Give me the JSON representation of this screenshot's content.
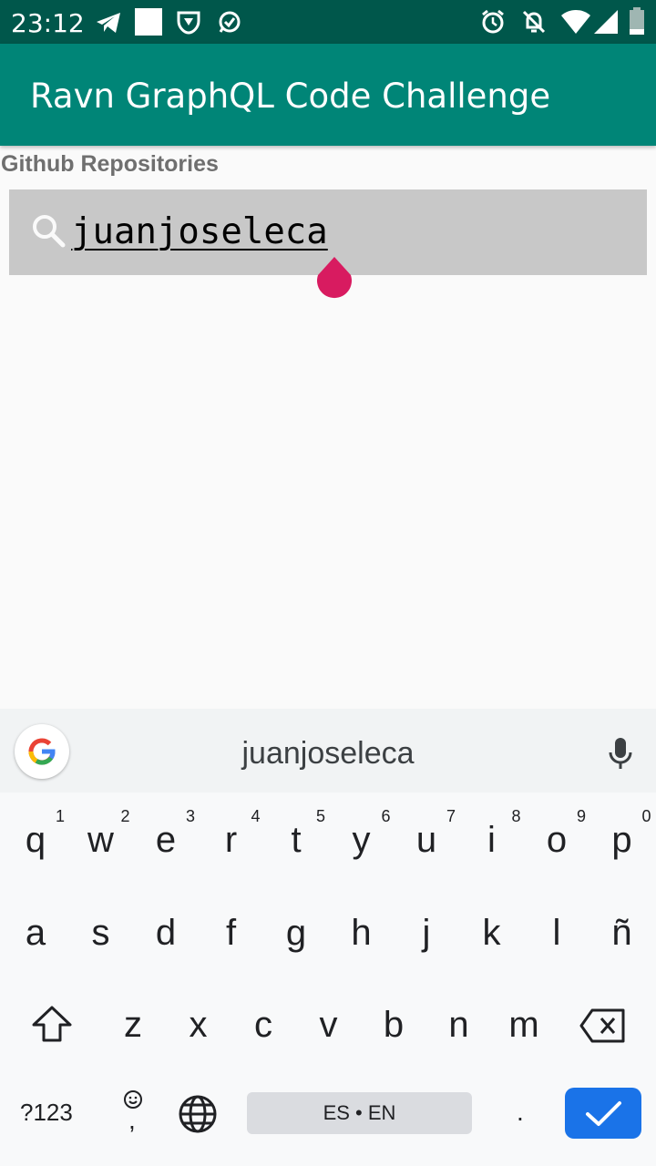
{
  "status_bar": {
    "time": "23:12",
    "left_icons": [
      "telegram-icon",
      "square-icon",
      "trophy-icon",
      "whatsapp-icon"
    ],
    "right_icons": [
      "alarm-icon",
      "notifications-off-icon",
      "wifi-icon",
      "signal-icon",
      "battery-icon"
    ]
  },
  "app_bar": {
    "title": "Ravn GraphQL Code Challenge"
  },
  "section": {
    "label": "Github Repositories"
  },
  "search": {
    "value": "juanjoseleca",
    "icon": "search-icon"
  },
  "colors": {
    "status_bar": "#00574b",
    "app_bar": "#008577",
    "accent": "#d81b60",
    "enter_key": "#1a73e8"
  },
  "keyboard": {
    "suggestion": "juanjoseleca",
    "row1": [
      {
        "key": "q",
        "hint": "1"
      },
      {
        "key": "w",
        "hint": "2"
      },
      {
        "key": "e",
        "hint": "3"
      },
      {
        "key": "r",
        "hint": "4"
      },
      {
        "key": "t",
        "hint": "5"
      },
      {
        "key": "y",
        "hint": "6"
      },
      {
        "key": "u",
        "hint": "7"
      },
      {
        "key": "i",
        "hint": "8"
      },
      {
        "key": "o",
        "hint": "9"
      },
      {
        "key": "p",
        "hint": "0"
      }
    ],
    "row2": [
      "a",
      "s",
      "d",
      "f",
      "g",
      "h",
      "j",
      "k",
      "l",
      "ñ"
    ],
    "row3": [
      "z",
      "x",
      "c",
      "v",
      "b",
      "n",
      "m"
    ],
    "symbols_label": "?123",
    "comma_label": ",",
    "space_label": "ES • EN",
    "period_label": "."
  }
}
